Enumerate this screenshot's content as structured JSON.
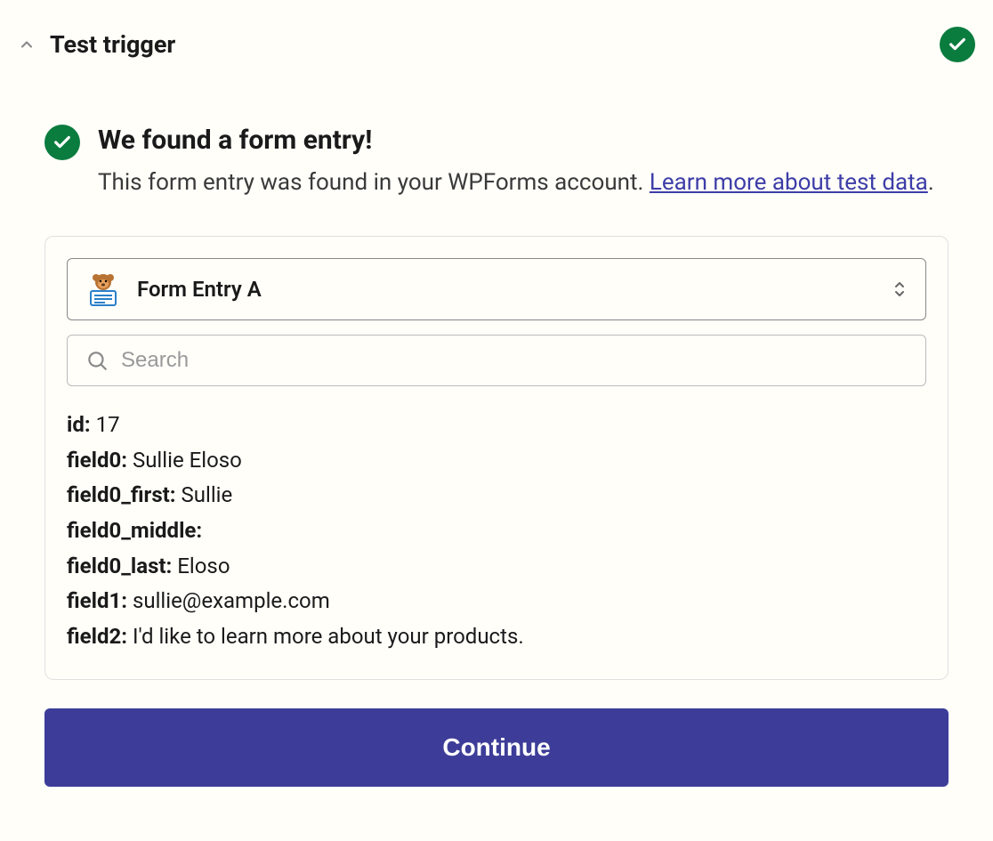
{
  "header": {
    "title": "Test trigger"
  },
  "success": {
    "title": "We found a form entry!",
    "desc_before_link": "This form entry was found in your WPForms account. ",
    "link_text": "Learn more about test data",
    "desc_after_link": "."
  },
  "entry_select": {
    "label": "Form Entry A"
  },
  "search": {
    "placeholder": "Search"
  },
  "fields": [
    {
      "key": "id",
      "value": "17"
    },
    {
      "key": "field0",
      "value": "Sullie Eloso"
    },
    {
      "key": "field0_first",
      "value": "Sullie"
    },
    {
      "key": "field0_middle",
      "value": ""
    },
    {
      "key": "field0_last",
      "value": "Eloso"
    },
    {
      "key": "field1",
      "value": "sullie@example.com"
    },
    {
      "key": "field2",
      "value": "I'd like to learn more about your products."
    }
  ],
  "continue_label": "Continue"
}
